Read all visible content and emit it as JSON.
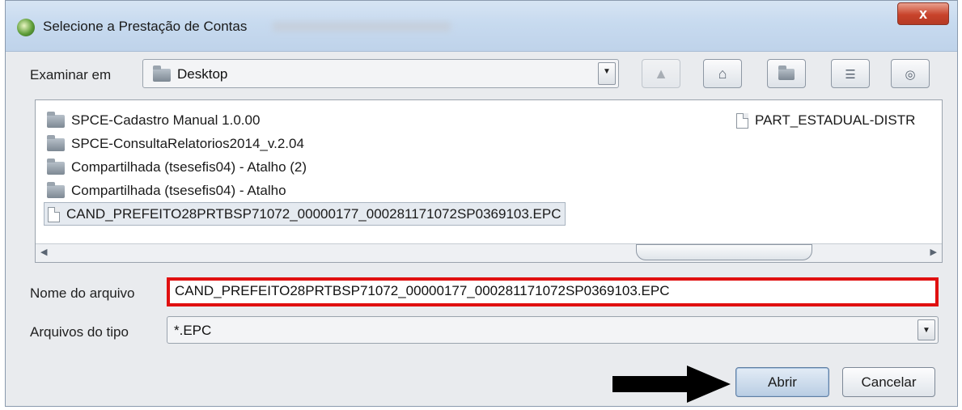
{
  "window": {
    "title": "Selecione a Prestação de Contas",
    "close_label": "x"
  },
  "look_in": {
    "label": "Examinar em",
    "value": "Desktop"
  },
  "toolbar": {
    "up_icon": "up-folder-icon",
    "home_icon": "home-icon",
    "new_folder_icon": "new-folder-icon",
    "list_view_icon": "list-view-icon",
    "details_view_icon": "details-view-icon"
  },
  "files": {
    "column1": [
      {
        "name": "SPCE-Cadastro Manual 1.0.00",
        "type": "folder"
      },
      {
        "name": "SPCE-ConsultaRelatorios2014_v.2.04",
        "type": "folder"
      },
      {
        "name": "Compartilhada (tsesefis04) - Atalho (2)",
        "type": "folder"
      },
      {
        "name": "Compartilhada (tsesefis04) - Atalho",
        "type": "folder"
      },
      {
        "name": "CAND_PREFEITO28PRTBSP71072_00000177_000281171072SP0369103.EPC",
        "type": "file",
        "selected": true
      }
    ],
    "column2": [
      {
        "name": "PART_ESTADUAL-DISTR",
        "type": "file"
      }
    ]
  },
  "filename": {
    "label": "Nome do arquivo",
    "value": "CAND_PREFEITO28PRTBSP71072_00000177_000281171072SP0369103.EPC"
  },
  "filetype": {
    "label": "Arquivos do tipo",
    "value": "*.EPC"
  },
  "buttons": {
    "open": "Abrir",
    "cancel": "Cancelar"
  },
  "colors": {
    "highlight_border": "#e01010",
    "arrow": "#000000"
  }
}
